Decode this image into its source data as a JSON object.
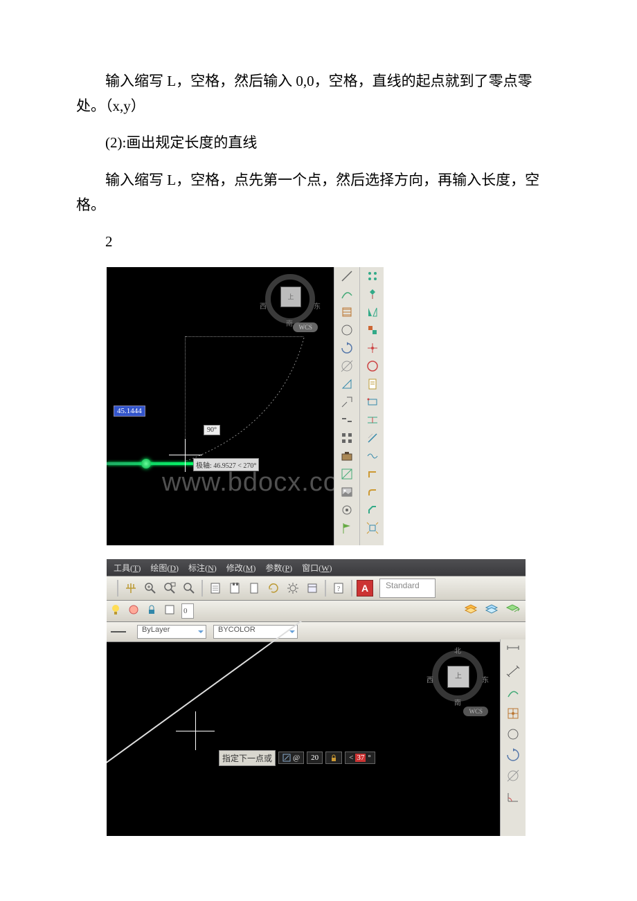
{
  "paragraphs": {
    "p1": "输入缩写 L，空格，然后输入 0,0，空格，直线的起点就到了零点零处。（x,y）",
    "p2": "(2):画出规定长度的直线",
    "p3": "输入缩写 L，空格，点先第一个点，然后选择方向，再输入长度，空格。",
    "p4": "2"
  },
  "fig1": {
    "dim_value": "45.1444",
    "angle_value": "90°",
    "polar_value": "极轴: 46.9527 < 270°",
    "viewcube": {
      "top": "上",
      "n": "南",
      "e": "东",
      "w": "西"
    },
    "wcs": "WCS",
    "watermark": "www.bdocx.com"
  },
  "fig2": {
    "menus": [
      {
        "label": "工具",
        "key": "T"
      },
      {
        "label": "绘图",
        "key": "D"
      },
      {
        "label": "标注",
        "key": "N"
      },
      {
        "label": "修改",
        "key": "M"
      },
      {
        "label": "参数",
        "key": "P"
      },
      {
        "label": "窗口",
        "key": "W"
      }
    ],
    "toolbar1": {
      "style_text": "Standard",
      "red_letter": "A"
    },
    "toolbar2": {
      "layer_name": "0"
    },
    "toolbar3": {
      "bylayer": "ByLayer",
      "bycolor": "BYCOLOR"
    },
    "canvas": {
      "prompt_text": "指定下一点或",
      "dist_value": "20",
      "angle_value": "37",
      "angle_prefix": "<",
      "viewcube": {
        "top": "上",
        "n": "北",
        "e": "东",
        "w": "西",
        "s": "南"
      },
      "wcs": "WCS"
    }
  }
}
